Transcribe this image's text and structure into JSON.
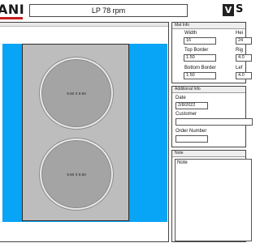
{
  "header": {
    "logo_text": "ANI",
    "title": "LP 78 rpm",
    "brand_badge": "V",
    "brand_text": "S"
  },
  "mat": {
    "openings": [
      {
        "label": "9.50 X 9.50"
      },
      {
        "label": "9.50 X 9.50"
      }
    ]
  },
  "mat_info": {
    "title": "Mat Info",
    "width_label": "Width",
    "width_value": "16",
    "height_label": "Hei",
    "height_value": "24",
    "top_border_label": "Top Border",
    "top_border_value": "1.50",
    "right_border_label": "Rig",
    "right_border_value": "4.0",
    "bottom_border_label": "Bottom Border",
    "bottom_border_value": "1.50",
    "left_border_label": "Lef",
    "left_border_value": "4.0"
  },
  "additional_info": {
    "title": "Additional Info",
    "date_label": "Date",
    "date_value": "2/8/2022",
    "customer_label": "Customer",
    "customer_value": "",
    "order_number_label": "Order Number",
    "order_number_value": ""
  },
  "note": {
    "title": "Note",
    "label": "Note",
    "value": ""
  },
  "colors": {
    "canvas_background": "#08a4f5",
    "mat_color": "#bdbdbd",
    "opening_color": "#a4a4a4",
    "brand_accent": "#c81e1e"
  },
  "icons": {
    "brand_badge": "v-logo-icon"
  }
}
